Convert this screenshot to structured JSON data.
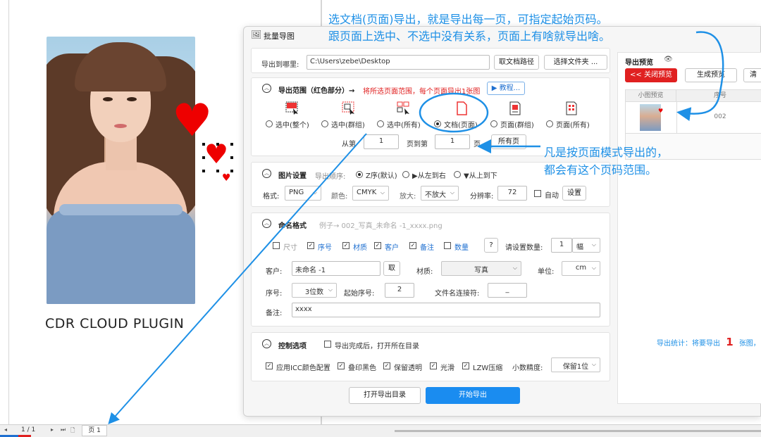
{
  "plugin_label": "CDR CLOUD PLUGIN",
  "dialog": {
    "title": "批量导图",
    "export_to_label": "导出到哪里:",
    "export_path": "C:\\Users\\zebe\\Desktop",
    "get_doc_path_button": "取文档路径",
    "choose_folder_button": "选择文件夹 ...",
    "range": {
      "title": "导出范围（红色部分）→",
      "hint": "将所选页面范围，每个页面导出1张图",
      "tutorial_button": "▶ 教程...",
      "options": [
        {
          "label": "选中(整个)",
          "selected": false
        },
        {
          "label": "选中(群组)",
          "selected": false
        },
        {
          "label": "选中(所有)",
          "selected": false
        },
        {
          "label": "文档(页面)",
          "selected": true
        },
        {
          "label": "页面(群组)",
          "selected": false
        },
        {
          "label": "页面(所有)",
          "selected": false
        }
      ],
      "from_label": "从第",
      "from_value": "1",
      "to_label": "页到第",
      "to_value": "1",
      "page_label": "页",
      "all_pages_button": "所有页"
    },
    "image": {
      "title": "图片设置",
      "order_label": "导出顺序:",
      "orders": [
        {
          "label": "Z序(默认)",
          "selected": true
        },
        {
          "label": "▶从左到右",
          "selected": false
        },
        {
          "label": "▼从上到下",
          "selected": false
        }
      ],
      "format_label": "格式:",
      "format": "PNG",
      "color_label": "颜色:",
      "color": "CMYK",
      "zoom_label": "放大:",
      "zoom": "不放大",
      "dpi_label": "分辨率:",
      "dpi": "72",
      "auto_label": "自动",
      "settings_button": "设置"
    },
    "naming": {
      "title": "命名格式",
      "example": "例子→ 002_写真_未命名 -1_xxxx.png",
      "checks": [
        {
          "label": "尺寸",
          "checked": false
        },
        {
          "label": "序号",
          "checked": true
        },
        {
          "label": "材质",
          "checked": true
        },
        {
          "label": "客户",
          "checked": true
        },
        {
          "label": "备注",
          "checked": true
        },
        {
          "label": "数量",
          "checked": false
        }
      ],
      "help_button": "?",
      "qty_label": "请设置数量:",
      "qty_value": "1",
      "qty_unit": "幅",
      "customer_label": "客户:",
      "customer_value": "未命名 -1",
      "take_button": "取",
      "material_label": "材质:",
      "material_value": "写真",
      "unit_label": "单位:",
      "unit_value": "cm",
      "seq_label": "序号:",
      "seq_digits": "3位数",
      "start_seq_label": "起始序号:",
      "start_seq_value": "2",
      "joiner_label": "文件名连接符:",
      "joiner_value": "_",
      "note_label": "备注:",
      "note_value": "xxxx"
    },
    "control": {
      "title": "控制选项",
      "open_after_label": "导出完成后，打开所在目录",
      "checks": [
        {
          "label": "应用ICC颜色配置",
          "checked": true
        },
        {
          "label": "叠印黑色",
          "checked": true
        },
        {
          "label": "保留透明",
          "checked": true
        },
        {
          "label": "光滑",
          "checked": true
        },
        {
          "label": "LZW压缩",
          "checked": true
        }
      ],
      "precision_label": "小数精度:",
      "precision_value": "保留1位"
    },
    "open_dir_button": "打开导出目录",
    "start_button": "开始导出",
    "preview": {
      "title": "导出预览",
      "close_button": "<< 关闭预览",
      "generate_button": "生成预览",
      "clear_button": "清",
      "col_thumb": "小图预览",
      "col_seq": "序号",
      "row_seq": "002",
      "stats_prefix": "导出统计：将要导出",
      "stats_count": "1",
      "stats_suffix": "张图，"
    }
  },
  "annotations": {
    "top_line1": "选文档(页面)导出，就是导出每一页，可指定起始页码。",
    "top_line2": "跟页面上选中、不选中没有关系，页面上有啥就导出啥。",
    "right_line1": "凡是按页面模式导出的，",
    "right_line2": "都会有这个页码范围。"
  },
  "statusbar": {
    "page_counter": "1 / 1",
    "page_tab": "页 1"
  },
  "colors": {
    "accent_blue": "#1e90e6",
    "start_button": "#1a8cf0",
    "close_preview": "#e02020",
    "heart": "#ee0000"
  }
}
